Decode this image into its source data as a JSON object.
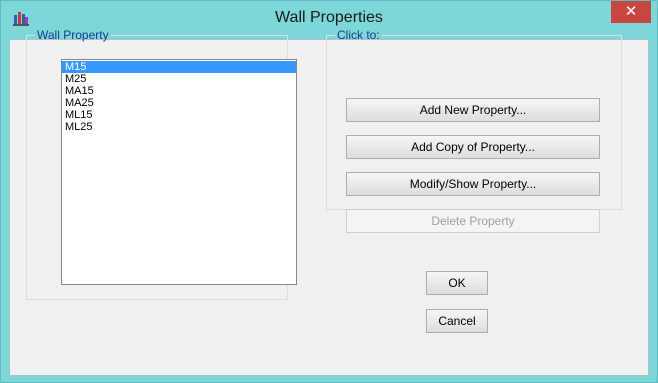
{
  "window": {
    "title": "Wall Properties",
    "close_glyph": "✕",
    "app_icon": "app-icon"
  },
  "wall_property": {
    "legend": "Wall Property",
    "items": [
      "M15",
      "M25",
      "MA15",
      "MA25",
      "ML15",
      "ML25"
    ],
    "selected": "M15"
  },
  "click_to": {
    "legend": "Click to:",
    "add_new": "Add New Property...",
    "add_copy": "Add Copy of Property...",
    "modify_show": "Modify/Show Property...",
    "delete": "Delete Property"
  },
  "buttons": {
    "ok": "OK",
    "cancel": "Cancel"
  },
  "colors": {
    "title_bar": "#7dd6d8",
    "close_button": "#c7463f",
    "selection": "#3399ff",
    "group_label": "#1a3c8f"
  }
}
